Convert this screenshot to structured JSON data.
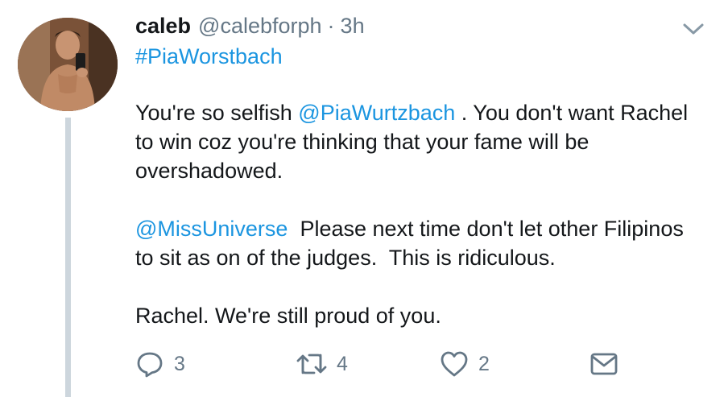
{
  "tweet": {
    "display_name": "caleb",
    "handle": "@calebforph",
    "separator": "·",
    "time": "3h",
    "hashtag": "#PiaWorstbach",
    "body": {
      "p1_before": "You're so selfish ",
      "p1_mention": "@PiaWurtzbach",
      "p1_after": " . You don't want Rachel to win coz you're thinking that your fame will be overshadowed.",
      "p2_mention": "@MissUniverse",
      "p2_after": "  Please next time don't let other Filipinos to sit as on of the judges.  This is ridiculous.",
      "p3": "Rachel. We're still proud of you."
    },
    "actions": {
      "reply_icon": "reply-icon",
      "reply_count": "3",
      "retweet_icon": "retweet-icon",
      "retweet_count": "4",
      "like_icon": "heart-icon",
      "like_count": "2",
      "dm_icon": "envelope-icon"
    },
    "menu_icon": "chevron-down-icon"
  },
  "colors": {
    "link": "#1b95e0",
    "secondary_text": "#657786",
    "primary_text": "#14171a",
    "thread_line": "#cdd6dd",
    "icon": "#657786"
  }
}
